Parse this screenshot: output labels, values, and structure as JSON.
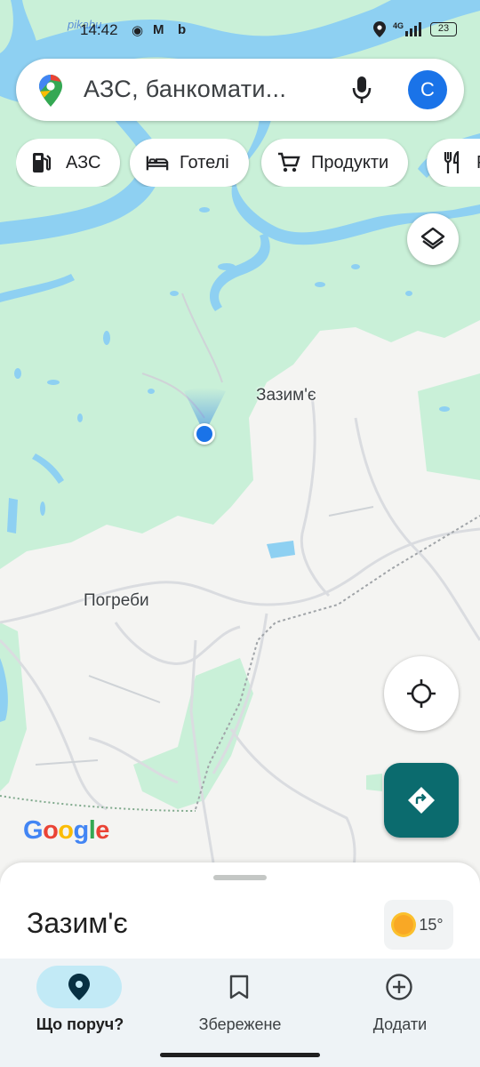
{
  "status_bar": {
    "time": "14:42",
    "watermark": "pikabu",
    "network": "4G",
    "battery": "23"
  },
  "search": {
    "placeholder": "АЗС, банкомати...",
    "avatar_letter": "С",
    "icons": [
      "google-maps-pin-icon",
      "microphone-icon"
    ]
  },
  "chips": [
    {
      "label": "АЗС",
      "icon": "gas-station-icon"
    },
    {
      "label": "Готелі",
      "icon": "bed-icon"
    },
    {
      "label": "Продукти",
      "icon": "cart-icon"
    },
    {
      "label": "Р",
      "icon": "restaurant-icon"
    }
  ],
  "map": {
    "labels": {
      "town_1": "Зазим'є",
      "town_2": "Погреби"
    },
    "attribution": "Google",
    "colors": {
      "water": "#8ed0f2",
      "forest": "#c9f0d8",
      "land": "#f4f4f2",
      "location_dot": "#1a73e8",
      "direction_button": "#0b6b6e"
    }
  },
  "bottom_sheet": {
    "place_name": "Зазим'є",
    "weather": "15°"
  },
  "nav": {
    "items": [
      {
        "label": "Що поруч?",
        "icon": "location-pin-icon",
        "active": true
      },
      {
        "label": "Збережене",
        "icon": "bookmark-icon",
        "active": false
      },
      {
        "label": "Додати",
        "icon": "add-circle-icon",
        "active": false
      }
    ]
  }
}
